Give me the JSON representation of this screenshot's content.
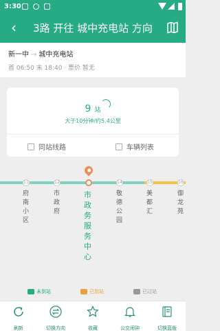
{
  "status_bar": {
    "time": "3:30"
  },
  "header": {
    "title": "3路 开往 城中充电站 方向",
    "back_icon": "back-arrow-icon",
    "map_icon": "map-icon"
  },
  "route_info": {
    "from": "新一中",
    "arrow": "→",
    "to": "城中充电站",
    "schedule": "首 06:50 末 18:40 · 票价 暂无"
  },
  "arrival_card": {
    "count": "9",
    "count_unit": "站",
    "summary": "大于10分钟/约5.4公里",
    "stops_button": "同站线路",
    "vehicles_button": "车辆列表"
  },
  "stations": [
    {
      "index": "11",
      "name": "府南小区"
    },
    {
      "index": "12",
      "name": "市政府"
    },
    {
      "index": "",
      "name": "市政务服务中心",
      "current": true
    },
    {
      "index": "14",
      "name": "敬德公园"
    },
    {
      "index": "15",
      "name": "美都汇"
    },
    {
      "index": "16",
      "name": "御龙苑"
    }
  ],
  "legend": {
    "arrived": "未到站",
    "arriving": "已到站",
    "passed": "已过站"
  },
  "toolbar": {
    "refresh": "刷新",
    "switch": "切换方向",
    "favorite": "收藏",
    "remind": "公交闹钟",
    "board": "切换蓝版"
  },
  "colors": {
    "primary": "#27ab85",
    "line_teal": "#7dd3c0",
    "line_yellow": "#f5c442",
    "current": "#f08c5a"
  }
}
